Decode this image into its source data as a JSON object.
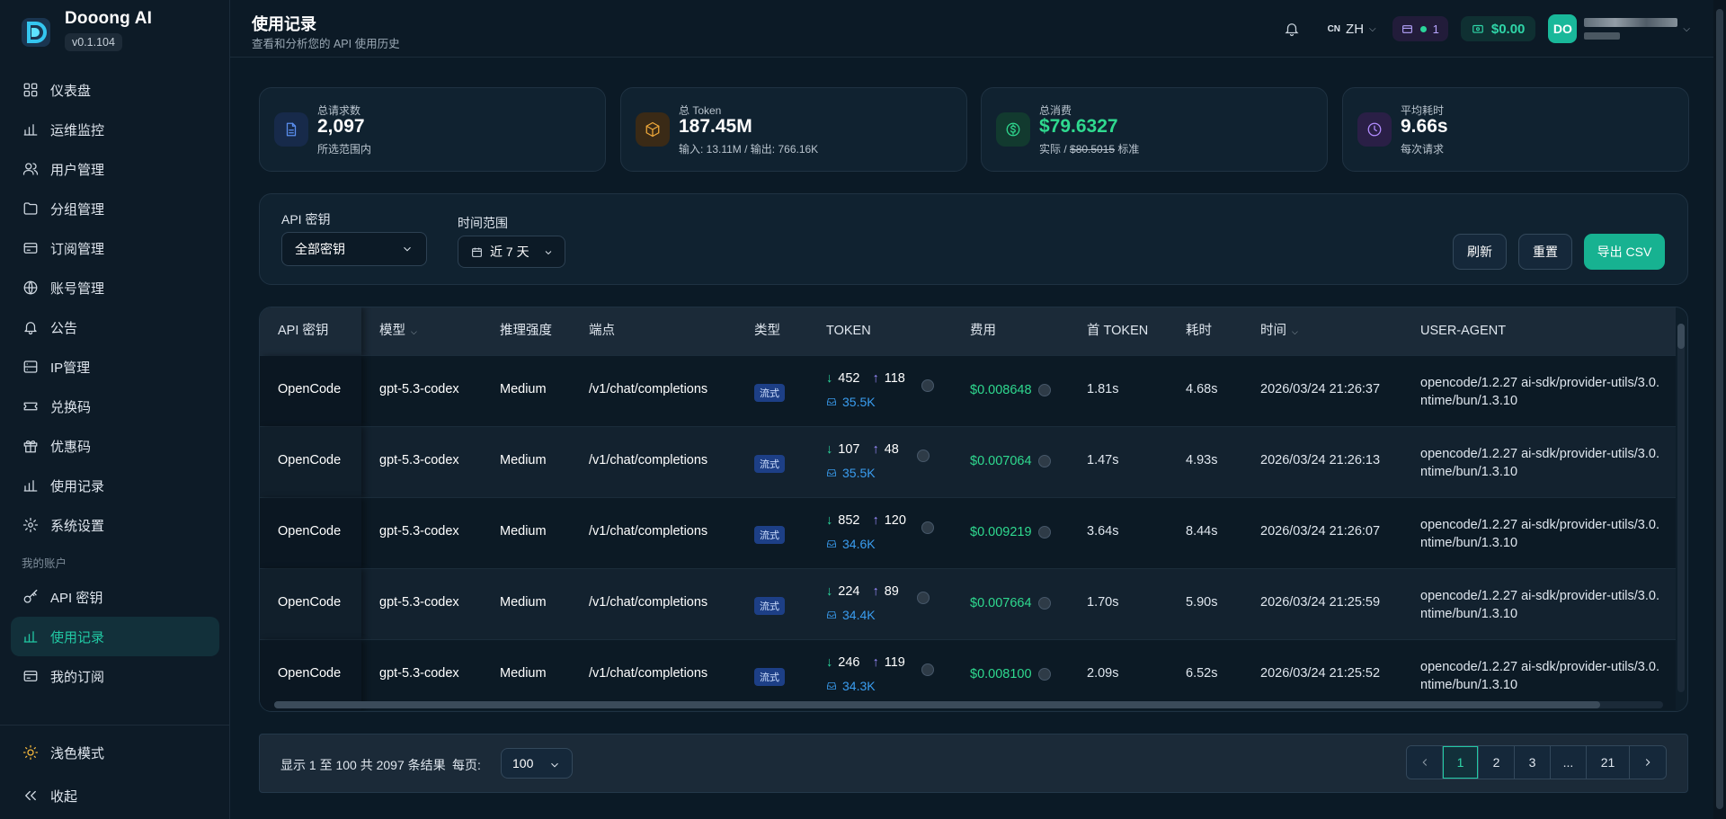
{
  "brand": {
    "name": "Dooong AI",
    "version": "v0.1.104"
  },
  "nav": {
    "items": [
      {
        "label": "仪表盘",
        "icon": "dashboard-icon"
      },
      {
        "label": "运维监控",
        "icon": "bar-chart-icon"
      },
      {
        "label": "用户管理",
        "icon": "users-icon"
      },
      {
        "label": "分组管理",
        "icon": "folder-icon"
      },
      {
        "label": "订阅管理",
        "icon": "card-icon"
      },
      {
        "label": "账号管理",
        "icon": "globe-icon"
      },
      {
        "label": "公告",
        "icon": "bell-icon"
      },
      {
        "label": "IP管理",
        "icon": "server-icon"
      },
      {
        "label": "兑换码",
        "icon": "ticket-icon"
      },
      {
        "label": "优惠码",
        "icon": "gift-icon"
      },
      {
        "label": "使用记录",
        "icon": "bar-chart-icon"
      },
      {
        "label": "系统设置",
        "icon": "gear-icon"
      }
    ],
    "section_label": "我的账户",
    "account_items": [
      {
        "label": "API 密钥",
        "icon": "key-icon"
      },
      {
        "label": "使用记录",
        "icon": "bar-chart-icon"
      },
      {
        "label": "我的订阅",
        "icon": "card-icon"
      }
    ],
    "theme_toggle": "浅色模式",
    "collapse": "收起"
  },
  "header": {
    "title": "使用记录",
    "subtitle": "查看和分析您的 API 使用历史",
    "lang_flag": "CN",
    "lang": "ZH",
    "subscription_count": "1",
    "balance": "$0.00",
    "avatar": "DO"
  },
  "stats": [
    {
      "label": "总请求数",
      "value": "2,097",
      "sub": "所选范围内"
    },
    {
      "label": "总 Token",
      "value": "187.45M",
      "sub": "输入: 13.11M / 输出: 766.16K"
    },
    {
      "label": "总消费",
      "value": "$79.6327",
      "sub_prefix": "实际 / ",
      "sub_strike": "$80.5015",
      "sub_suffix": " 标准"
    },
    {
      "label": "平均耗时",
      "value": "9.66s",
      "sub": "每次请求"
    }
  ],
  "filters": {
    "api_key_label": "API 密钥",
    "api_key_value": "全部密钥",
    "time_label": "时间范围",
    "time_value": "近 7 天",
    "refresh": "刷新",
    "reset": "重置",
    "export": "导出 CSV"
  },
  "table": {
    "headers": [
      "API 密钥",
      "模型",
      "推理强度",
      "端点",
      "类型",
      "TOKEN",
      "费用",
      "首 TOKEN",
      "耗时",
      "时间",
      "USER-AGENT"
    ],
    "rows": [
      {
        "key": "OpenCode",
        "model": "gpt-5.3-codex",
        "effort": "Medium",
        "endpoint": "/v1/chat/completions",
        "type": "流式",
        "in": "452",
        "out": "118",
        "cache": "35.5K",
        "cost": "$0.008648",
        "first": "1.81s",
        "dur": "4.68s",
        "time": "2026/03/24 21:26:37",
        "ua1": "opencode/1.2.27 ai-sdk/provider-utils/3.0.",
        "ua2": "ntime/bun/1.3.10"
      },
      {
        "key": "OpenCode",
        "model": "gpt-5.3-codex",
        "effort": "Medium",
        "endpoint": "/v1/chat/completions",
        "type": "流式",
        "in": "107",
        "out": "48",
        "cache": "35.5K",
        "cost": "$0.007064",
        "first": "1.47s",
        "dur": "4.93s",
        "time": "2026/03/24 21:26:13",
        "ua1": "opencode/1.2.27 ai-sdk/provider-utils/3.0.",
        "ua2": "ntime/bun/1.3.10"
      },
      {
        "key": "OpenCode",
        "model": "gpt-5.3-codex",
        "effort": "Medium",
        "endpoint": "/v1/chat/completions",
        "type": "流式",
        "in": "852",
        "out": "120",
        "cache": "34.6K",
        "cost": "$0.009219",
        "first": "3.64s",
        "dur": "8.44s",
        "time": "2026/03/24 21:26:07",
        "ua1": "opencode/1.2.27 ai-sdk/provider-utils/3.0.",
        "ua2": "ntime/bun/1.3.10"
      },
      {
        "key": "OpenCode",
        "model": "gpt-5.3-codex",
        "effort": "Medium",
        "endpoint": "/v1/chat/completions",
        "type": "流式",
        "in": "224",
        "out": "89",
        "cache": "34.4K",
        "cost": "$0.007664",
        "first": "1.70s",
        "dur": "5.90s",
        "time": "2026/03/24 21:25:59",
        "ua1": "opencode/1.2.27 ai-sdk/provider-utils/3.0.",
        "ua2": "ntime/bun/1.3.10"
      },
      {
        "key": "OpenCode",
        "model": "gpt-5.3-codex",
        "effort": "Medium",
        "endpoint": "/v1/chat/completions",
        "type": "流式",
        "in": "246",
        "out": "119",
        "cache": "34.3K",
        "cost": "$0.008100",
        "first": "2.09s",
        "dur": "6.52s",
        "time": "2026/03/24 21:25:52",
        "ua1": "opencode/1.2.27 ai-sdk/provider-utils/3.0.",
        "ua2": "ntime/bun/1.3.10"
      }
    ]
  },
  "pagination": {
    "info": "显示 1 至 100 共 2097 条结果",
    "per_page_label": "每页:",
    "per_page": "100",
    "pages": [
      "1",
      "2",
      "3",
      "...",
      "21"
    ]
  }
}
